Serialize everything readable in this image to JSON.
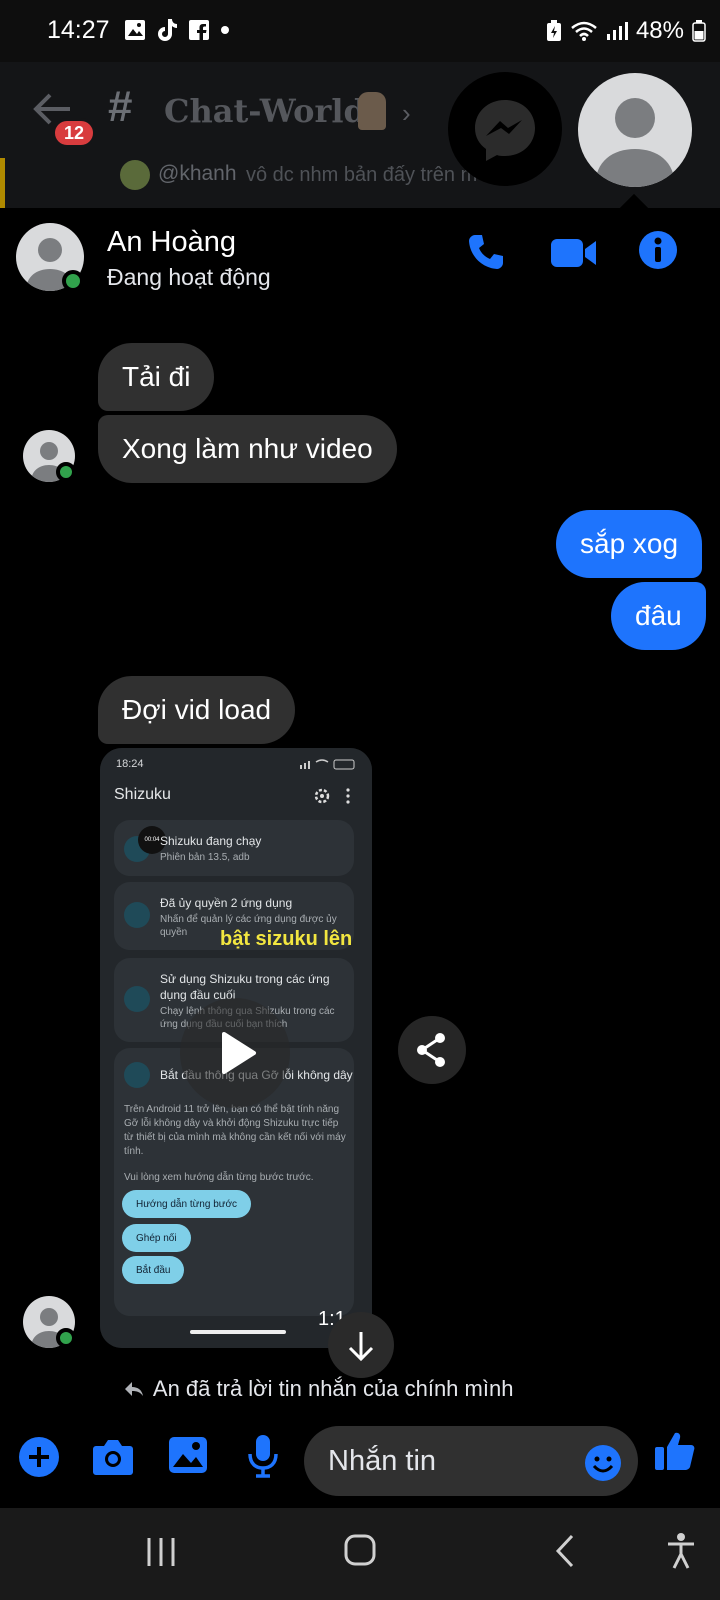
{
  "status_bar": {
    "time": "14:27",
    "battery": "48%",
    "notification_icons": [
      "gallery-icon",
      "tiktok-icon",
      "facebook-icon",
      "dot-icon"
    ],
    "system_icons": [
      "battery-saver-icon",
      "wifi-icon",
      "signal-icon",
      "battery-icon"
    ]
  },
  "background_app": {
    "unread_count": "12",
    "channel_hash": "#",
    "channel_name": "Chat-World-",
    "mention": "@khanh",
    "message_preview": "vô dc nhm bản đấy trên m"
  },
  "chat": {
    "contact_name": "An Hoàng",
    "contact_status": "Đang hoạt động",
    "accent_color": "#1e74fd",
    "online_color": "#31a24c"
  },
  "messages": [
    {
      "from": "them",
      "text": "Tải đi"
    },
    {
      "from": "them",
      "text": "Xong làm như video"
    },
    {
      "from": "me",
      "text": "sắp xog"
    },
    {
      "from": "me",
      "text": "đâu"
    },
    {
      "from": "them",
      "text": "Đợi vid load"
    }
  ],
  "video": {
    "duration": "1:1",
    "screen": {
      "status_time": "18:24",
      "app_title": "Shizuku",
      "timer_badge": "00:04",
      "card1_title": "Shizuku đang chạy",
      "card1_sub": "Phiên bản 13.5, adb",
      "card2_title": "Đã ủy quyền 2 ứng dụng",
      "card2_sub1": "Nhấn để quản lý các ứng dụng được ủy",
      "card2_sub2": "quyền",
      "caption": "bật sizuku lên",
      "card3_title1": "Sử dụng Shizuku trong các ứng",
      "card3_title2": "dụng đầu cuối",
      "card3_sub1": "Chạy lệnh thông qua Shizuku trong các",
      "card3_sub2": "ứng dụng đầu cuối bạn thích",
      "card4_title": "Bắt đầu thông qua Gỡ lỗi không dây",
      "card4_body1": "Trên Android 11 trở lên, bạn có thể bật tính năng",
      "card4_body2": "Gỡ lỗi không dây và khởi động Shizuku trực tiếp",
      "card4_body3": "từ thiết bị của mình mà không cần kết nối với máy",
      "card4_body4": "tính.",
      "card4_body5": "Vui lòng xem hướng dẫn từng bước trước.",
      "btn_guide": "Hướng dẫn từng bước",
      "btn_pair": "Ghép nối",
      "btn_start": "Bắt đầu"
    }
  },
  "reply_note": "An đã trả lời tin nhắn của chính mình",
  "composer": {
    "placeholder": "Nhắn tin"
  }
}
